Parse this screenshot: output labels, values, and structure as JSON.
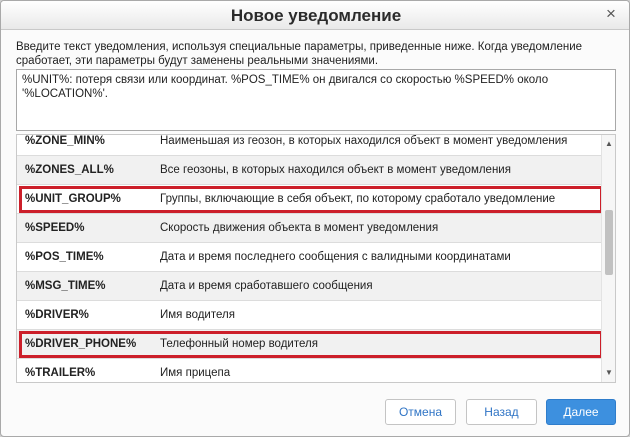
{
  "dialog": {
    "title": "Новое уведомление",
    "close_symbol": "×",
    "description": "Введите текст уведомления, используя специальные параметры, приведенные ниже. Когда уведомление сработает, эти параметры будут заменены реальными значениями.",
    "message_text": "%UNIT%: потеря связи или координат. %POS_TIME% он двигался со скоростью %SPEED% около '%LOCATION%'."
  },
  "params": [
    {
      "name": "%ZONE_MIN%",
      "desc": "Наименьшая из геозон, в которых находился объект в момент уведомления"
    },
    {
      "name": "%ZONES_ALL%",
      "desc": "Все геозоны, в которых находился объект в момент уведомления"
    },
    {
      "name": "%UNIT_GROUP%",
      "desc": "Группы, включающие в себя объект, по которому сработало уведомление"
    },
    {
      "name": "%SPEED%",
      "desc": "Скорость движения объекта в момент уведомления"
    },
    {
      "name": "%POS_TIME%",
      "desc": "Дата и время последнего сообщения с валидными координатами"
    },
    {
      "name": "%MSG_TIME%",
      "desc": "Дата и время сработавшего сообщения"
    },
    {
      "name": "%DRIVER%",
      "desc": "Имя водителя"
    },
    {
      "name": "%DRIVER_PHONE%",
      "desc": "Телефонный номер водителя"
    },
    {
      "name": "%TRAILER%",
      "desc": "Имя прицепа"
    }
  ],
  "scroll": {
    "up_symbol": "▲",
    "down_symbol": "▼"
  },
  "buttons": {
    "cancel": "Отмена",
    "back": "Назад",
    "next": "Далее"
  },
  "colors": {
    "highlight": "#cc1f2a",
    "primary_button": "#3d90df",
    "link_text": "#2f74c5"
  }
}
